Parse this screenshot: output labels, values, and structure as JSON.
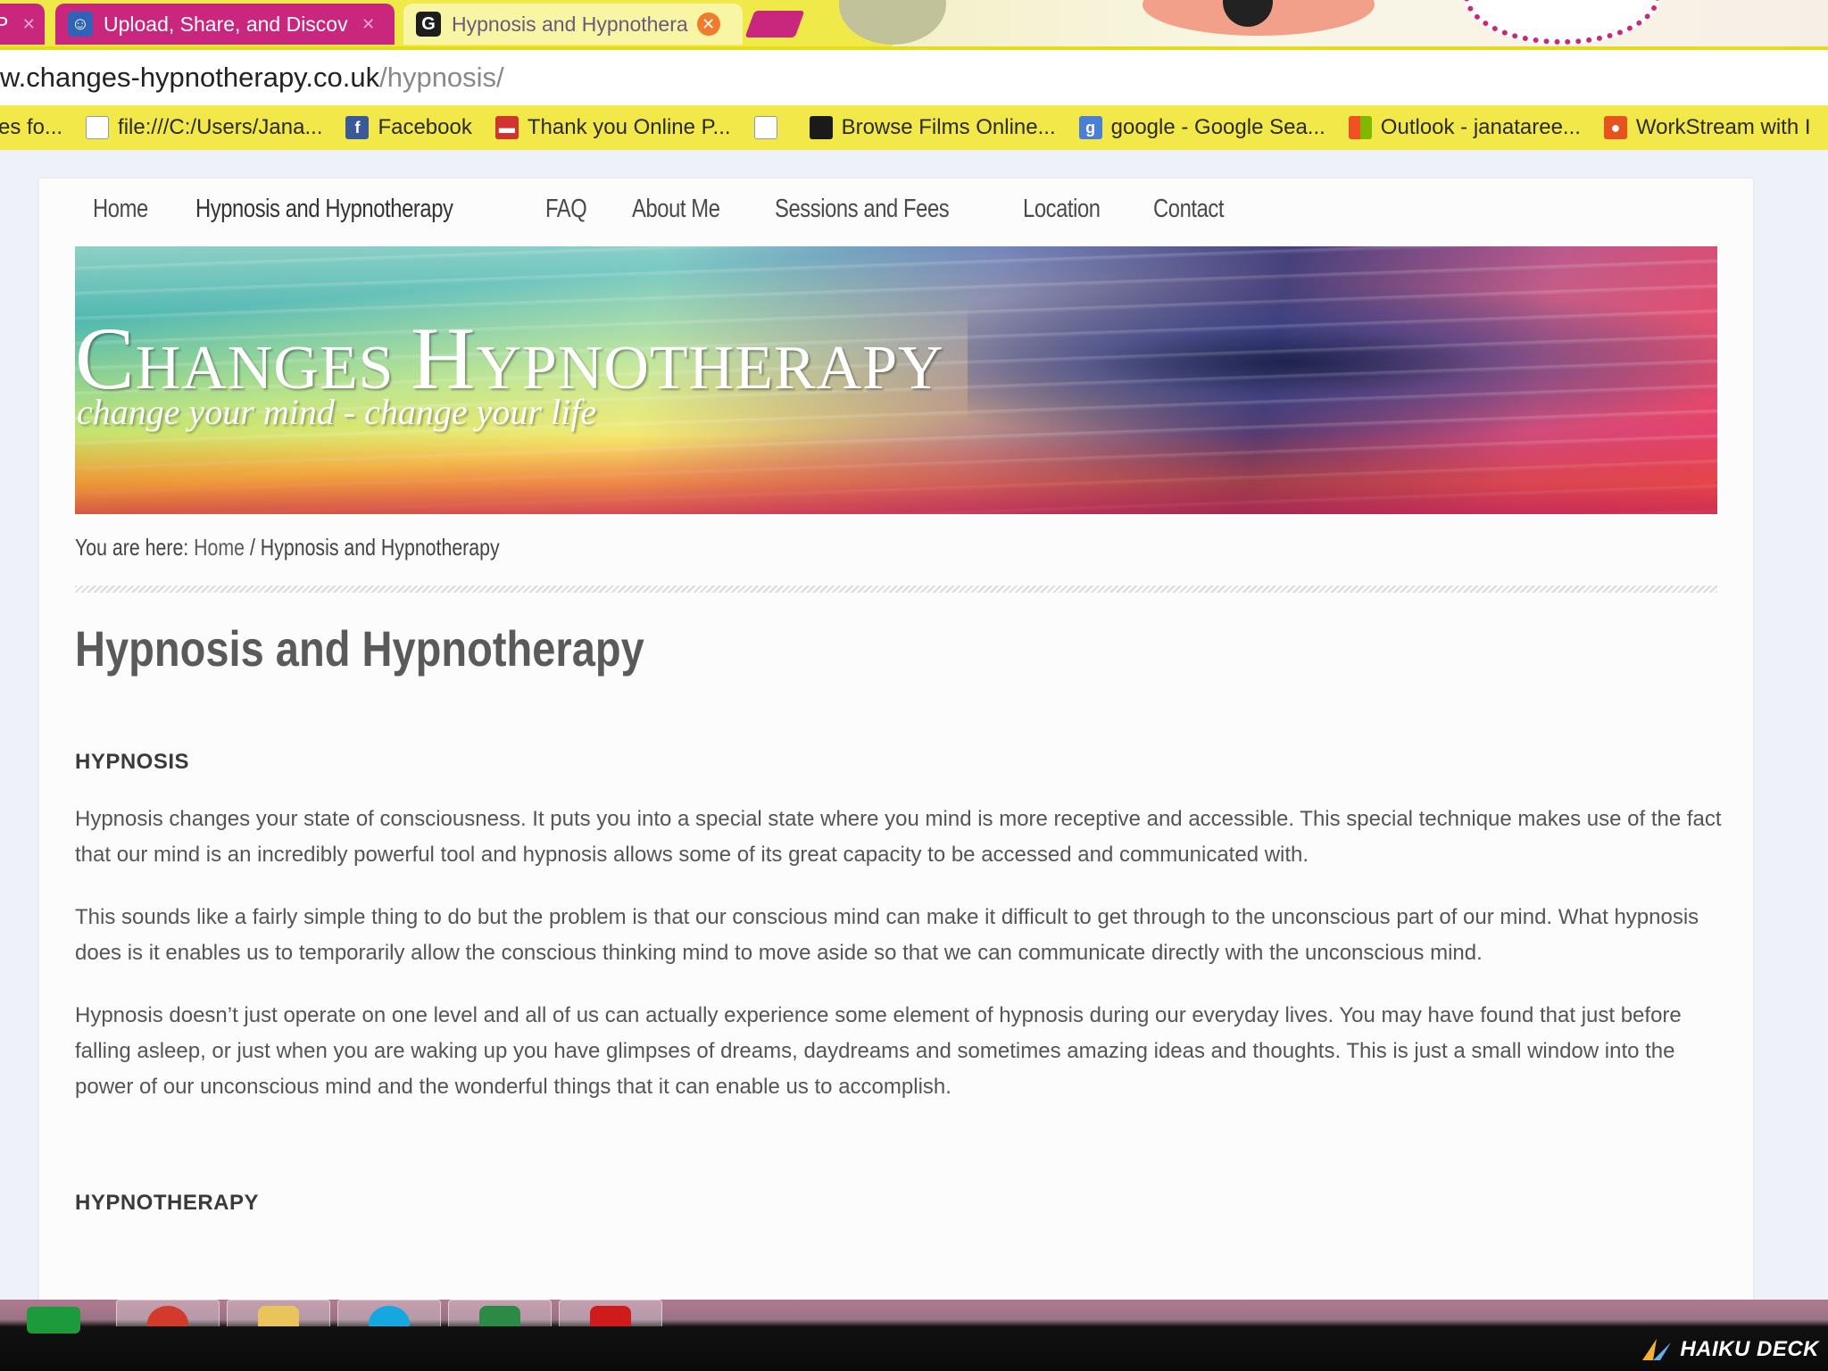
{
  "browser": {
    "tabs": [
      {
        "label": "P",
        "active": false
      },
      {
        "label": "Upload, Share, and Discov",
        "active": false,
        "icon": "people-icon"
      },
      {
        "label": "Hypnosis and Hypnothera",
        "active": true,
        "icon": "g-icon"
      }
    ],
    "address": {
      "host": "w.changes-hypnotherapy.co.uk",
      "path": "/hypnosis/"
    },
    "bookmarks": [
      {
        "label": "es fo...",
        "icon": "none"
      },
      {
        "label": "file:///C:/Users/Jana...",
        "icon": "page-icon"
      },
      {
        "label": "Facebook",
        "icon": "facebook-icon"
      },
      {
        "label": "Thank you Online P...",
        "icon": "car-icon"
      },
      {
        "label": "",
        "icon": "page-icon"
      },
      {
        "label": "Browse Films Online...",
        "icon": "films-icon"
      },
      {
        "label": "google - Google Sea...",
        "icon": "google-icon"
      },
      {
        "label": "Outlook - janataree...",
        "icon": "microsoft-icon"
      },
      {
        "label": "WorkStream with I",
        "icon": "workstream-icon"
      }
    ]
  },
  "site": {
    "nav": [
      "Home",
      "Hypnosis and Hypnotherapy",
      "FAQ",
      "About Me",
      "Sessions and Fees",
      "Location",
      "Contact"
    ],
    "title_initial_1": "C",
    "title_rest_1": "HANGES ",
    "title_initial_2": "H",
    "title_rest_2": "YPNOTHERAPY",
    "tagline": "change your mind - change your life",
    "breadcrumb": {
      "prefix": "You are here: ",
      "home": "Home",
      "sep": " / ",
      "current": "Hypnosis and Hypnotherapy"
    },
    "page_title": "Hypnosis and Hypnotherapy",
    "sections": {
      "hypnosis_heading": "HYPNOSIS",
      "p1": "Hypnosis changes your state of consciousness. It puts you into a special state where you mind is more receptive and accessible. This special technique makes use of the fact that our mind is an incredibly powerful tool and hypnosis allows some of its great capacity to be accessed and communicated with.",
      "p2": "This sounds like a fairly simple thing to do but the problem is that our conscious mind can make it difficult to get through to the unconscious part of our mind. What hypnosis does is it enables us to temporarily allow the conscious thinking mind to move aside so that we can communicate directly with the unconscious mind.",
      "p3": "Hypnosis doesn’t just operate on one level and all of us can actually experience some element of hypnosis during our everyday lives. You may have found that just before falling asleep, or just when you are waking up you have glimpses of dreams, daydreams and sometimes amazing ideas and thoughts. This is just a small window into the power of our unconscious mind and the wonderful things that it can enable us to accomplish.",
      "hypnotherapy_heading": "HYPNOTHERAPY"
    }
  },
  "watermark": "HAIKU DECK",
  "colors": {
    "tab_inactive": "#c8277d",
    "tab_bar": "#f0e94a",
    "bookmarks_bar": "#f2e84a"
  }
}
